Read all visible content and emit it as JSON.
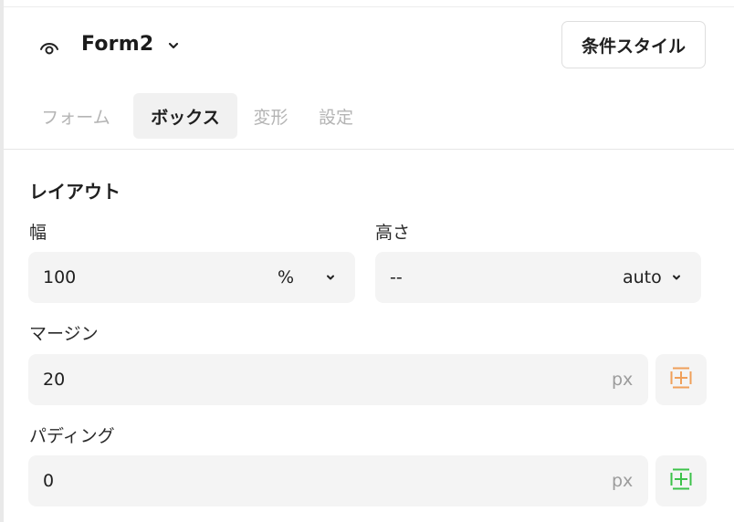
{
  "header": {
    "form_name": "Form2",
    "condition_style_label": "条件スタイル"
  },
  "tabs": [
    {
      "label": "フォーム",
      "active": false
    },
    {
      "label": "ボックス",
      "active": true
    },
    {
      "label": "変形",
      "active": false
    },
    {
      "label": "設定",
      "active": false
    }
  ],
  "layout": {
    "section_title": "レイアウト",
    "width": {
      "label": "幅",
      "value": "100",
      "unit": "%"
    },
    "height": {
      "label": "高さ",
      "value": "--",
      "unit": "auto"
    },
    "margin": {
      "label": "マージン",
      "value": "20",
      "unit": "px",
      "icon": "margin-spacing-icon",
      "icon_color": "#f0a05a"
    },
    "padding": {
      "label": "パディング",
      "value": "0",
      "unit": "px",
      "icon": "padding-spacing-icon",
      "icon_color": "#3cc24a"
    }
  }
}
